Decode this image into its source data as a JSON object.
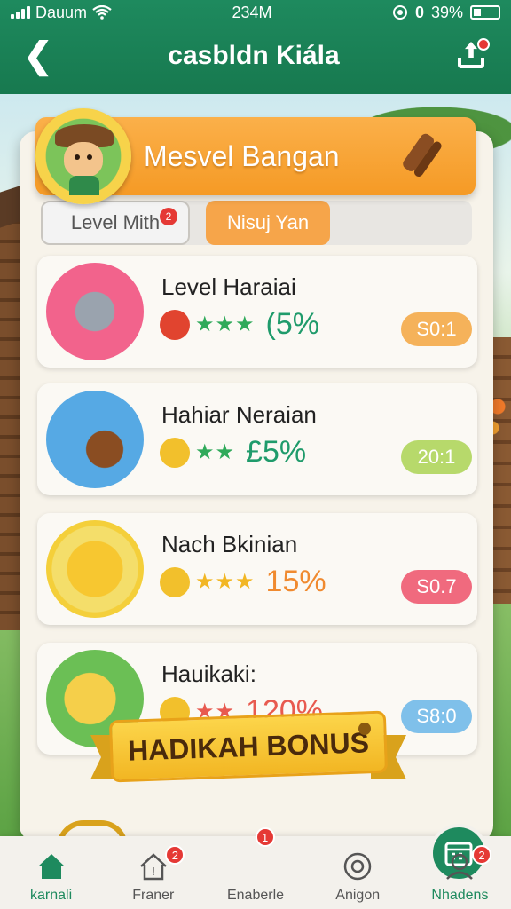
{
  "status_bar": {
    "carrier": "Dauum",
    "time": "234M",
    "battery": "39%"
  },
  "header": {
    "title": "casbldn Kiála"
  },
  "banner": {
    "title": "Mesvel Bangan"
  },
  "tabs": [
    {
      "label": "Level Mith",
      "badge": "2"
    },
    {
      "label": "Nisuj Yan"
    }
  ],
  "levels": [
    {
      "name": "Level Haraiai",
      "percent": "(5%",
      "value": "S0:1",
      "pill_color": "#f5b25a",
      "pct_color": "#1f9b6b",
      "circle_color": "#f2638c"
    },
    {
      "name": "Hahiar Neraian",
      "percent": "£5%",
      "value": "20:1",
      "pill_color": "#b7d96b",
      "pct_color": "#1f9b6b",
      "circle_color": "#56a9e4"
    },
    {
      "name": "Nach Bkinian",
      "percent": "15%",
      "value": "S0.7",
      "pill_color": "#f06a7e",
      "pct_color": "#f08a2f",
      "circle_color": "#f4cf3a"
    },
    {
      "name": "Hauikaki:",
      "percent": "120%",
      "value": "S8:0",
      "pill_color": "#7fc0ea",
      "pct_color": "#e85a4f",
      "circle_color": "#6bbf55"
    }
  ],
  "bonus": {
    "label": "HADIKAH BONUS"
  },
  "nav": [
    {
      "label": "karnali",
      "icon": "home-icon",
      "badge": ""
    },
    {
      "label": "Franer",
      "icon": "house-alert-icon",
      "badge": "2"
    },
    {
      "label": "Enaberle",
      "icon": "calendar-icon",
      "badge": "1"
    },
    {
      "label": "Anigon",
      "icon": "target-icon",
      "badge": ""
    },
    {
      "label": "Nhadens",
      "icon": "profile-icon",
      "badge": "2"
    }
  ]
}
